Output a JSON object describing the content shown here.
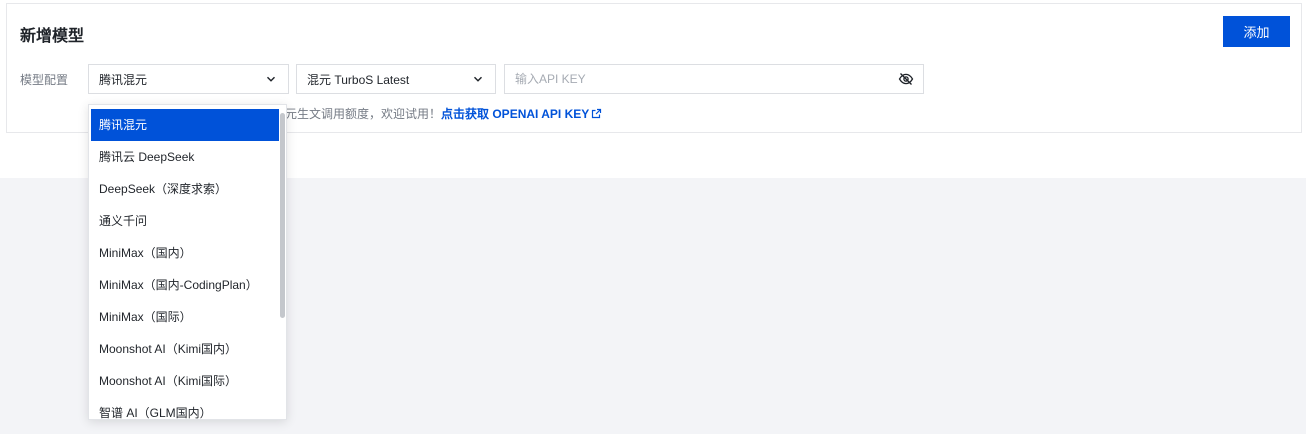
{
  "header": {
    "title": "新增模型",
    "add_label": "添加"
  },
  "form": {
    "label": "模型配置",
    "provider_value": "腾讯混元",
    "model_value": "混元 TurboS Latest",
    "api_key_value": "",
    "api_key_placeholder": "输入API KEY"
  },
  "hint": {
    "text": "元生文调用额度，欢迎试用！",
    "link": "点击获取 OPENAI API KEY"
  },
  "dropdown": {
    "items": [
      {
        "label": "腾讯混元",
        "selected": true
      },
      {
        "label": "腾讯云 DeepSeek"
      },
      {
        "label": "DeepSeek（深度求索）"
      },
      {
        "label": "通义千问"
      },
      {
        "label": "MiniMax（国内）"
      },
      {
        "label": "MiniMax（国内-CodingPlan）"
      },
      {
        "label": "MiniMax（国际）"
      },
      {
        "label": "Moonshot AI（Kimi国内）"
      },
      {
        "label": "Moonshot AI（Kimi国际）"
      },
      {
        "label": "智谱 AI（GLM国内）"
      }
    ]
  },
  "colors": {
    "accent": "#0052d9",
    "page_background": "#f3f4f7",
    "panel_background": "#ffffff",
    "muted_text": "#757b85"
  }
}
